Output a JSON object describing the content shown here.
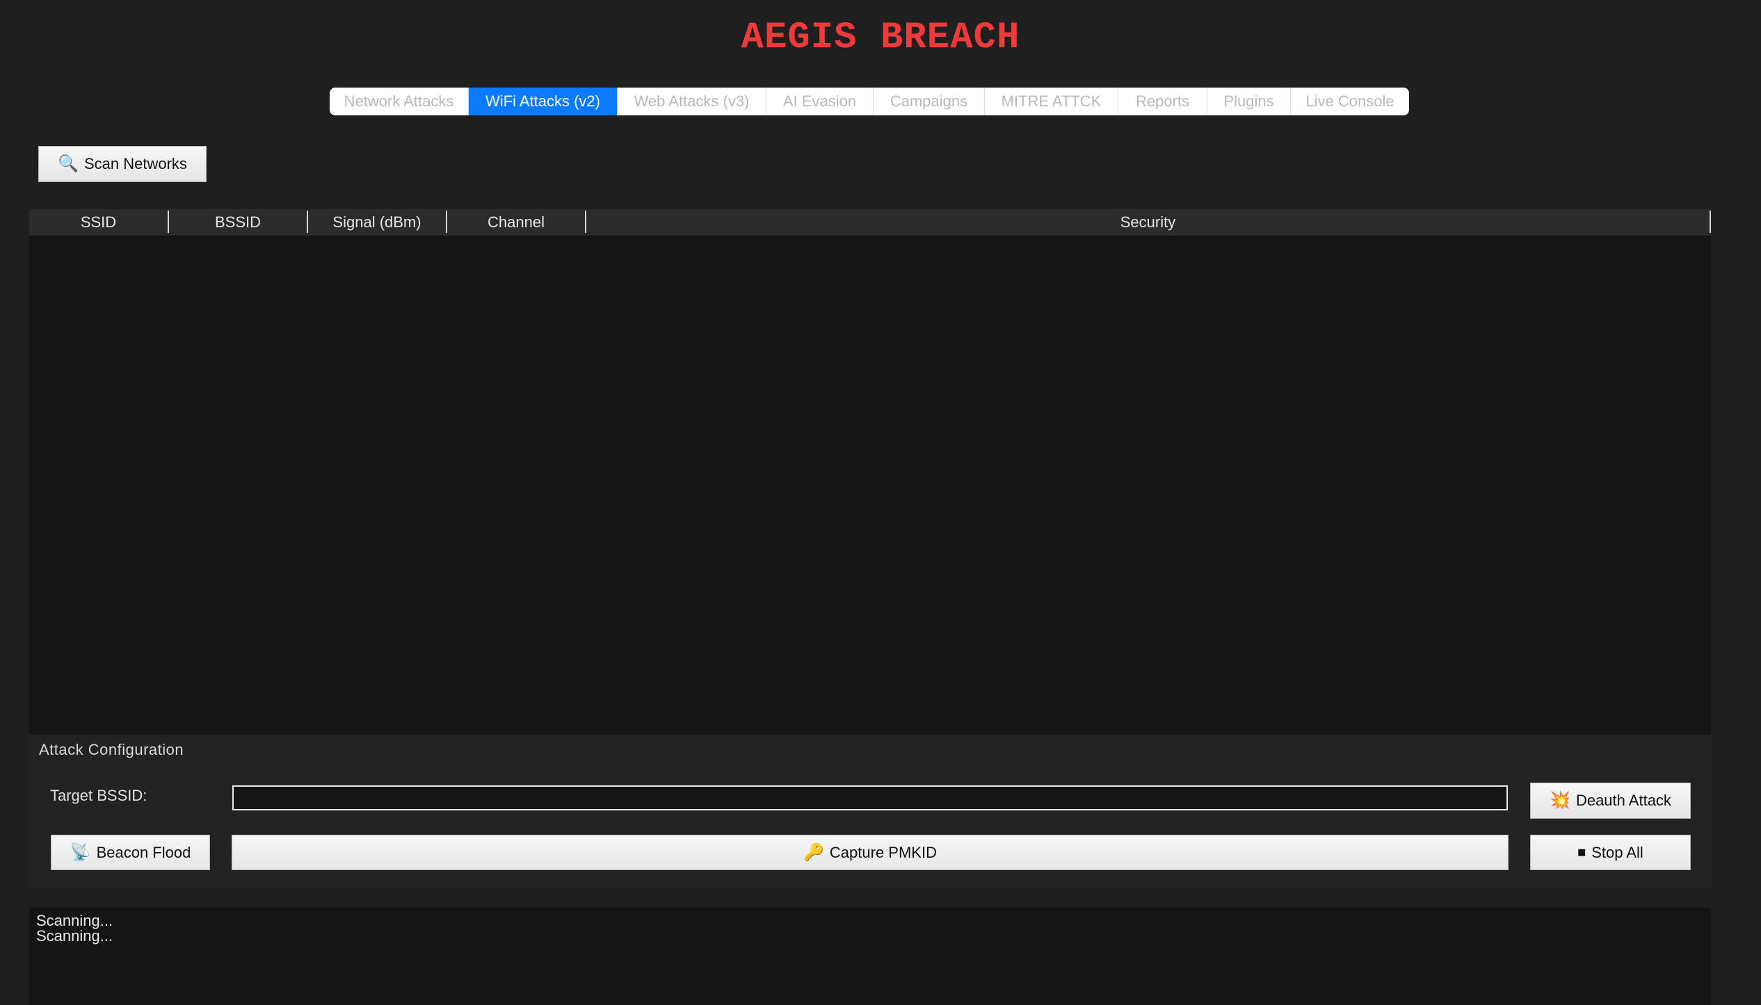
{
  "app": {
    "title": "AEGIS BREACH"
  },
  "tabs": [
    {
      "label": "Network Attacks",
      "active": false
    },
    {
      "label": "WiFi Attacks (v2)",
      "active": true
    },
    {
      "label": "Web Attacks (v3)",
      "active": false
    },
    {
      "label": "AI Evasion",
      "active": false
    },
    {
      "label": "Campaigns",
      "active": false
    },
    {
      "label": "MITRE ATTCK",
      "active": false
    },
    {
      "label": "Reports",
      "active": false
    },
    {
      "label": "Plugins",
      "active": false
    },
    {
      "label": "Live Console",
      "active": false
    }
  ],
  "scan": {
    "button_label": "Scan Networks",
    "icon": "magnifier-icon"
  },
  "networks_table": {
    "columns": [
      "SSID",
      "BSSID",
      "Signal (dBm)",
      "Channel",
      "Security"
    ],
    "rows": []
  },
  "attack_config": {
    "section_label": "Attack Configuration",
    "target_bssid_label": "Target BSSID:",
    "target_bssid_value": "",
    "deauth_label": "Deauth Attack",
    "deauth_icon": "collision-icon",
    "beacon_label": "Beacon Flood",
    "beacon_icon": "satellite-dish-icon",
    "pmkid_label": "Capture PMKID",
    "pmkid_icon": "key-icon",
    "stop_label": "Stop All",
    "stop_icon": "stop-square-icon"
  },
  "log": {
    "lines": [
      "Scanning...",
      "Scanning..."
    ]
  },
  "colors": {
    "background": "#1f1f1f",
    "title": "#ee3a3a",
    "active_tab": "#0a7aff",
    "panel": "#141414"
  }
}
